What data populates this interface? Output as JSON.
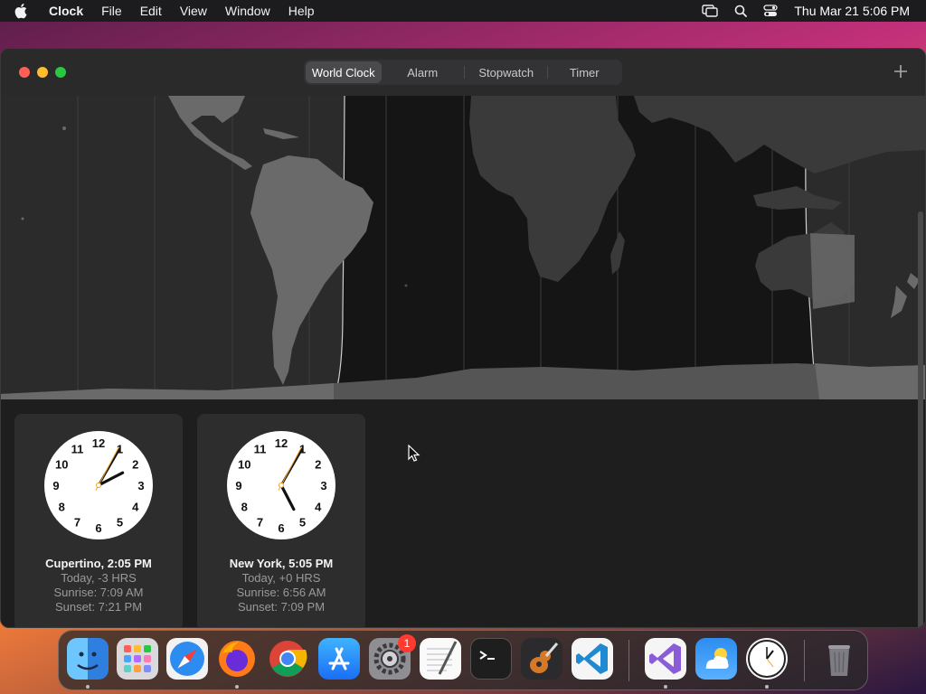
{
  "menubar": {
    "app_name": "Clock",
    "items": [
      "File",
      "Edit",
      "View",
      "Window",
      "Help"
    ],
    "datetime": "Thu Mar 21  5:06 PM"
  },
  "toolbar": {
    "tabs": [
      {
        "label": "World Clock",
        "active": true
      },
      {
        "label": "Alarm",
        "active": false
      },
      {
        "label": "Stopwatch",
        "active": false
      },
      {
        "label": "Timer",
        "active": false
      }
    ],
    "add_label": "+"
  },
  "clocks": [
    {
      "city": "Cupertino, 2:05 PM",
      "offset": "Today, -3 HRS",
      "sunrise": "Sunrise: 7:09 AM",
      "sunset": "Sunset: 7:21 PM",
      "time_hours": 2,
      "time_minutes": 5
    },
    {
      "city": "New York, 5:05 PM",
      "offset": "Today, +0 HRS",
      "sunrise": "Sunrise: 6:56 AM",
      "sunset": "Sunset: 7:09 PM",
      "time_hours": 5,
      "time_minutes": 5
    }
  ],
  "clock_numbers": [
    "12",
    "1",
    "2",
    "3",
    "4",
    "5",
    "6",
    "7",
    "8",
    "9",
    "10",
    "11"
  ],
  "dock": {
    "apps": [
      "finder-icon",
      "launchpad-icon",
      "safari-icon",
      "firefox-icon",
      "chrome-icon",
      "app-store-icon",
      "system-settings-icon",
      "textedit-icon",
      "terminal-icon",
      "garageband-icon",
      "vscode-icon",
      "visual-studio-icon",
      "weather-icon",
      "clock-app-icon",
      "trash-icon"
    ],
    "settings_badge": "1"
  },
  "colors": {
    "accent_second_hand": "#f0a020",
    "close": "#ff5f57",
    "minimize": "#febc2e",
    "maximize": "#28c840"
  }
}
